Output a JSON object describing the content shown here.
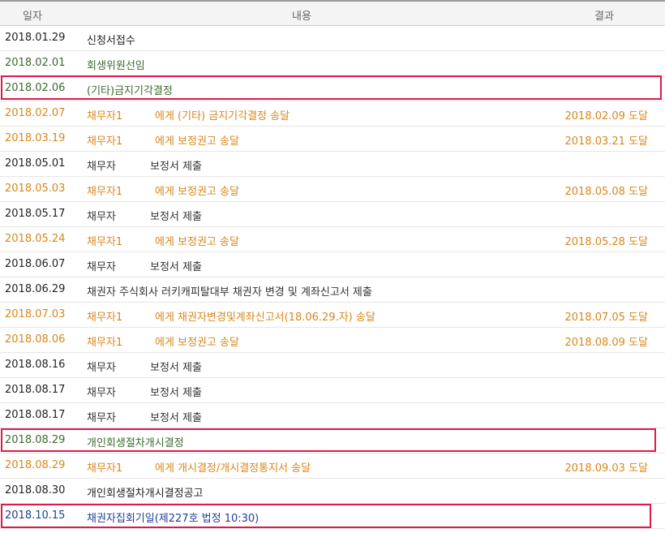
{
  "header": {
    "date": "일자",
    "content": "내용",
    "result": "결과"
  },
  "colors": {
    "green": "#3b6b2e",
    "orange": "#d8871c",
    "blue": "#1f3f9a",
    "highlight": "#e0194a"
  },
  "rows": [
    {
      "date": "2018.01.29",
      "content": "신청서접수",
      "party": "",
      "rest": "",
      "result": ""
    },
    {
      "date": "2018.02.01",
      "content": "회생위원선임",
      "party": "",
      "rest": "",
      "result": ""
    },
    {
      "date": "2018.02.06",
      "content": "(기타)금지기각결정",
      "party": "",
      "rest": "",
      "result": ""
    },
    {
      "date": "2018.02.07",
      "content": "",
      "party": "채무자1",
      "rest": "에게 (기타) 금지기각결정 송달",
      "result": "2018.02.09 도달"
    },
    {
      "date": "2018.03.19",
      "content": "",
      "party": "채무자1",
      "rest": "에게 보정권고 송달",
      "result": "2018.03.21 도달"
    },
    {
      "date": "2018.05.01",
      "content": "",
      "party": "채무자",
      "rest": "보정서 제출",
      "result": ""
    },
    {
      "date": "2018.05.03",
      "content": "",
      "party": "채무자1",
      "rest": "에게 보정권고 송달",
      "result": "2018.05.08 도달"
    },
    {
      "date": "2018.05.17",
      "content": "",
      "party": "채무자",
      "rest": "보정서 제출",
      "result": ""
    },
    {
      "date": "2018.05.24",
      "content": "",
      "party": "채무자1",
      "rest": "에게 보정권고 송달",
      "result": "2018.05.28 도달"
    },
    {
      "date": "2018.06.07",
      "content": "",
      "party": "채무자",
      "rest": "보정서 제출",
      "result": ""
    },
    {
      "date": "2018.06.29",
      "content": "채권자 주식회사 러키캐피탈대부 채권자 변경 및 계좌신고서 제출",
      "party": "",
      "rest": "",
      "result": ""
    },
    {
      "date": "2018.07.03",
      "content": "",
      "party": "채무자1",
      "rest": "에게 채권자변경및계좌신고서(18.06.29.자) 송달",
      "result": "2018.07.05 도달"
    },
    {
      "date": "2018.08.06",
      "content": "",
      "party": "채무자1",
      "rest": "에게 보정권고 송달",
      "result": "2018.08.09 도달"
    },
    {
      "date": "2018.08.16",
      "content": "",
      "party": "채무자",
      "rest": "보정서 제출",
      "result": ""
    },
    {
      "date": "2018.08.17",
      "content": "",
      "party": "채무자",
      "rest": "보정서 제출",
      "result": ""
    },
    {
      "date": "2018.08.17",
      "content": "",
      "party": "채무자",
      "rest": "보정서 제출",
      "result": ""
    },
    {
      "date": "2018.08.29",
      "content": "개인회생절차개시결정",
      "party": "",
      "rest": "",
      "result": ""
    },
    {
      "date": "2018.08.29",
      "content": "",
      "party": "채무자1",
      "rest": "에게 개시결정/개시결정통지서 송달",
      "result": "2018.09.03 도달"
    },
    {
      "date": "2018.08.30",
      "content": "개인회생절차개시결정공고",
      "party": "",
      "rest": "",
      "result": ""
    },
    {
      "date": "2018.10.15",
      "content": "채권자집회기일(제227호 법정 10:30)",
      "party": "",
      "rest": "",
      "result": ""
    }
  ]
}
